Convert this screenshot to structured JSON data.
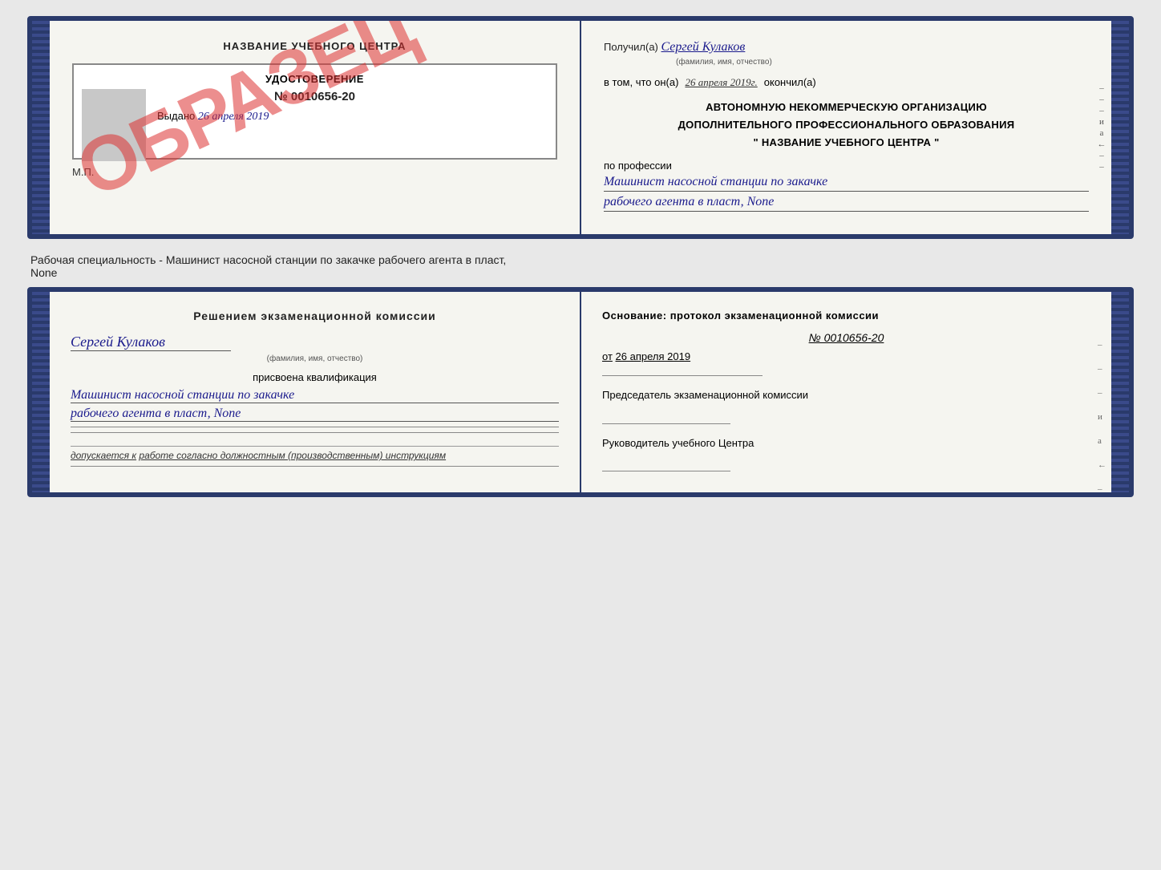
{
  "top": {
    "left": {
      "title": "НАЗВАНИЕ УЧЕБНОГО ЦЕНТРА",
      "stamp_text": "ОБРАЗЕЦ",
      "cert_header": "УДОСТОВЕРЕНИЕ",
      "cert_number": "№ 0010656-20",
      "issued_label": "Выдано",
      "issued_date": "26 апреля 2019",
      "mp_label": "М.П."
    },
    "right": {
      "received_label": "Получил(а)",
      "received_name": "Сергей Кулаков",
      "name_hint": "(фамилия, имя, отчество)",
      "date_prefix": "в том, что он(а)",
      "date_value": "26 апреля 2019г.",
      "date_suffix": "окончил(а)",
      "org_line1": "АВТОНОМНУЮ НЕКОММЕРЧЕСКУЮ ОРГАНИЗАЦИЮ",
      "org_line2": "ДОПОЛНИТЕЛЬНОГО ПРОФЕССИОНАЛЬНОГО ОБРАЗОВАНИЯ",
      "org_line3": "\" НАЗВАНИЕ УЧЕБНОГО ЦЕНТРА \"",
      "profession_label": "по профессии",
      "profession_line1": "Машинист насосной станции по закачке",
      "profession_line2": "рабочего агента в пласт, None"
    }
  },
  "separator": "Рабочая специальность - Машинист насосной станции по закачке рабочего агента в пласт,",
  "separator2": "None",
  "bottom": {
    "left": {
      "decision_title": "Решением экзаменационной комиссии",
      "person_name": "Сергей Кулаков",
      "name_hint": "(фамилия, имя, отчество)",
      "assigned_label": "присвоена квалификация",
      "qualification_line1": "Машинист насосной станции по закачке",
      "qualification_line2": "рабочего агента в пласт, None",
      "allowed_label": "допускается к",
      "allowed_value": "работе согласно должностным (производственным) инструкциям"
    },
    "right": {
      "basis_label": "Основание: протокол экзаменационной комиссии",
      "protocol_number": "№ 0010656-20",
      "date_prefix": "от",
      "date_value": "26 апреля 2019",
      "chairman_label": "Председатель экзаменационной комиссии",
      "director_label": "Руководитель учебного Центра"
    }
  },
  "side_marks": [
    "-",
    "-",
    "-",
    "и",
    "а",
    "←",
    "-",
    "-",
    "-",
    "-",
    "-"
  ],
  "side_marks2": [
    "-",
    "-",
    "-",
    "-",
    "и",
    "а",
    "←",
    "-",
    "-",
    "-",
    "-",
    "-"
  ]
}
